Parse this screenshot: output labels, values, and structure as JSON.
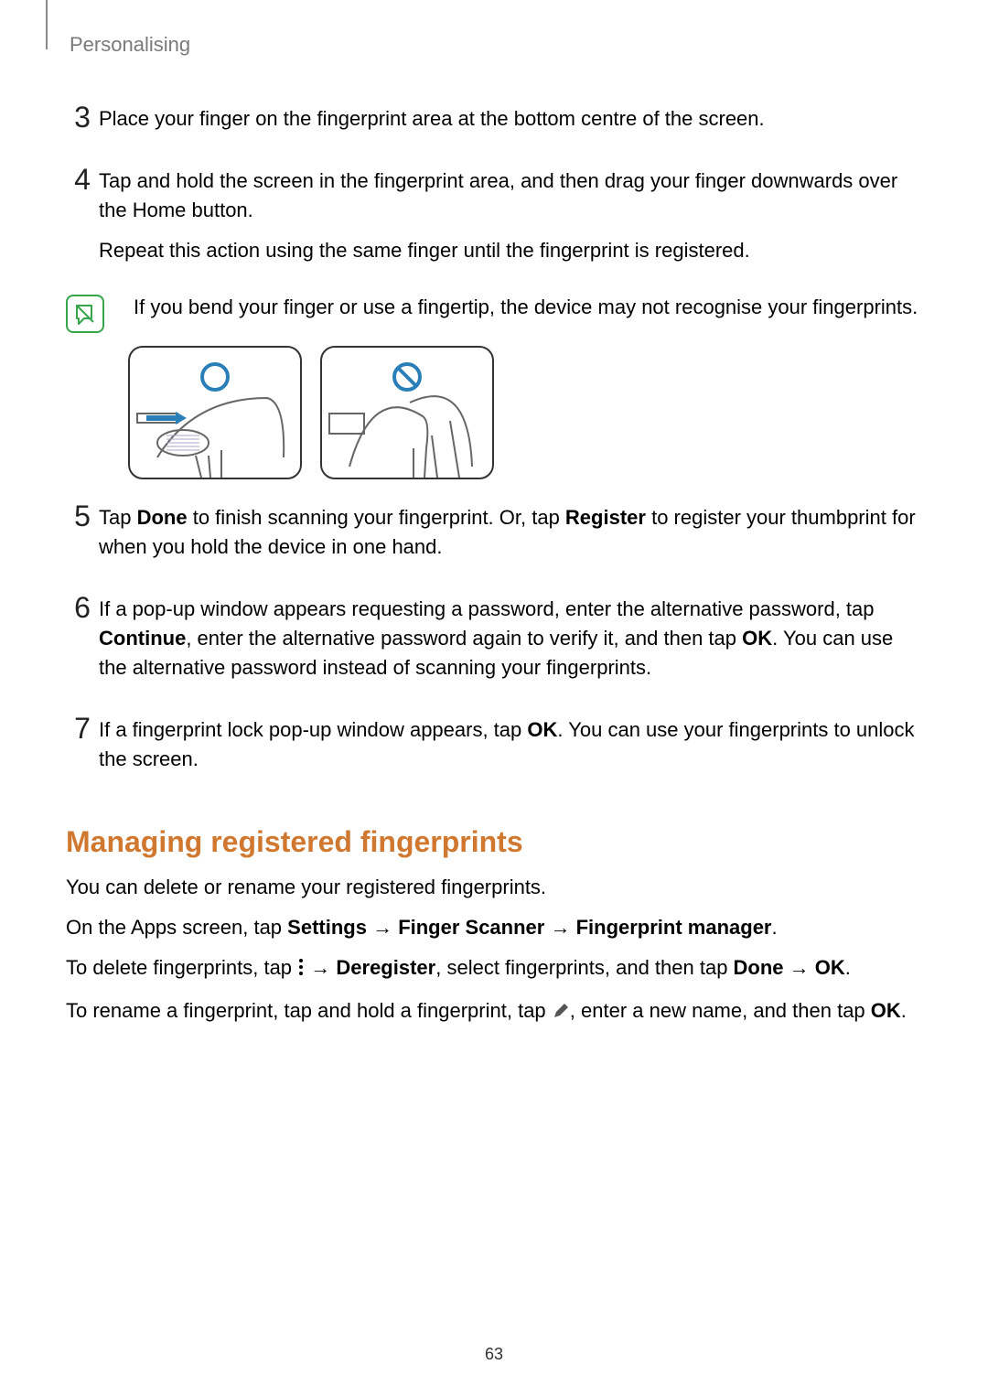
{
  "header": "Personalising",
  "steps": {
    "s3": {
      "num": "3",
      "text": "Place your finger on the fingerprint area at the bottom centre of the screen."
    },
    "s4": {
      "num": "4",
      "p1": "Tap and hold the screen in the fingerprint area, and then drag your finger downwards over the Home button.",
      "p2": "Repeat this action using the same finger until the fingerprint is registered."
    },
    "s5": {
      "num": "5",
      "pre": "Tap ",
      "b1": "Done",
      "mid1": " to finish scanning your fingerprint. Or, tap ",
      "b2": "Register",
      "post": " to register your thumbprint for when you hold the device in one hand."
    },
    "s6": {
      "num": "6",
      "pre": "If a pop-up window appears requesting a password, enter the alternative password, tap ",
      "b1": "Continue",
      "mid1": ", enter the alternative password again to verify it, and then tap ",
      "b2": "OK",
      "post": ". You can use the alternative password instead of scanning your fingerprints."
    },
    "s7": {
      "num": "7",
      "pre": "If a fingerprint lock pop-up window appears, tap ",
      "b1": "OK",
      "post": ". You can use your fingerprints to unlock the screen."
    }
  },
  "note": "If you bend your finger or use a fingertip, the device may not recognise your fingerprints.",
  "subheading": "Managing registered fingerprints",
  "managing": {
    "p1": "You can delete or rename your registered fingerprints.",
    "p2_pre": "On the Apps screen, tap ",
    "p2_b1": "Settings",
    "p2_arrow": " → ",
    "p2_b2": "Finger Scanner",
    "p2_b3": "Fingerprint manager",
    "p2_end": ".",
    "p3_pre": "To delete fingerprints, tap ",
    "p3_arrow": " → ",
    "p3_b1": "Deregister",
    "p3_mid": ", select fingerprints, and then tap ",
    "p3_b2": "Done",
    "p3_b3": "OK",
    "p3_end": ".",
    "p4_pre": "To rename a fingerprint, tap and hold a fingerprint, tap ",
    "p4_mid": ", enter a new name, and then tap ",
    "p4_b1": "OK",
    "p4_end": "."
  },
  "page_number": "63"
}
